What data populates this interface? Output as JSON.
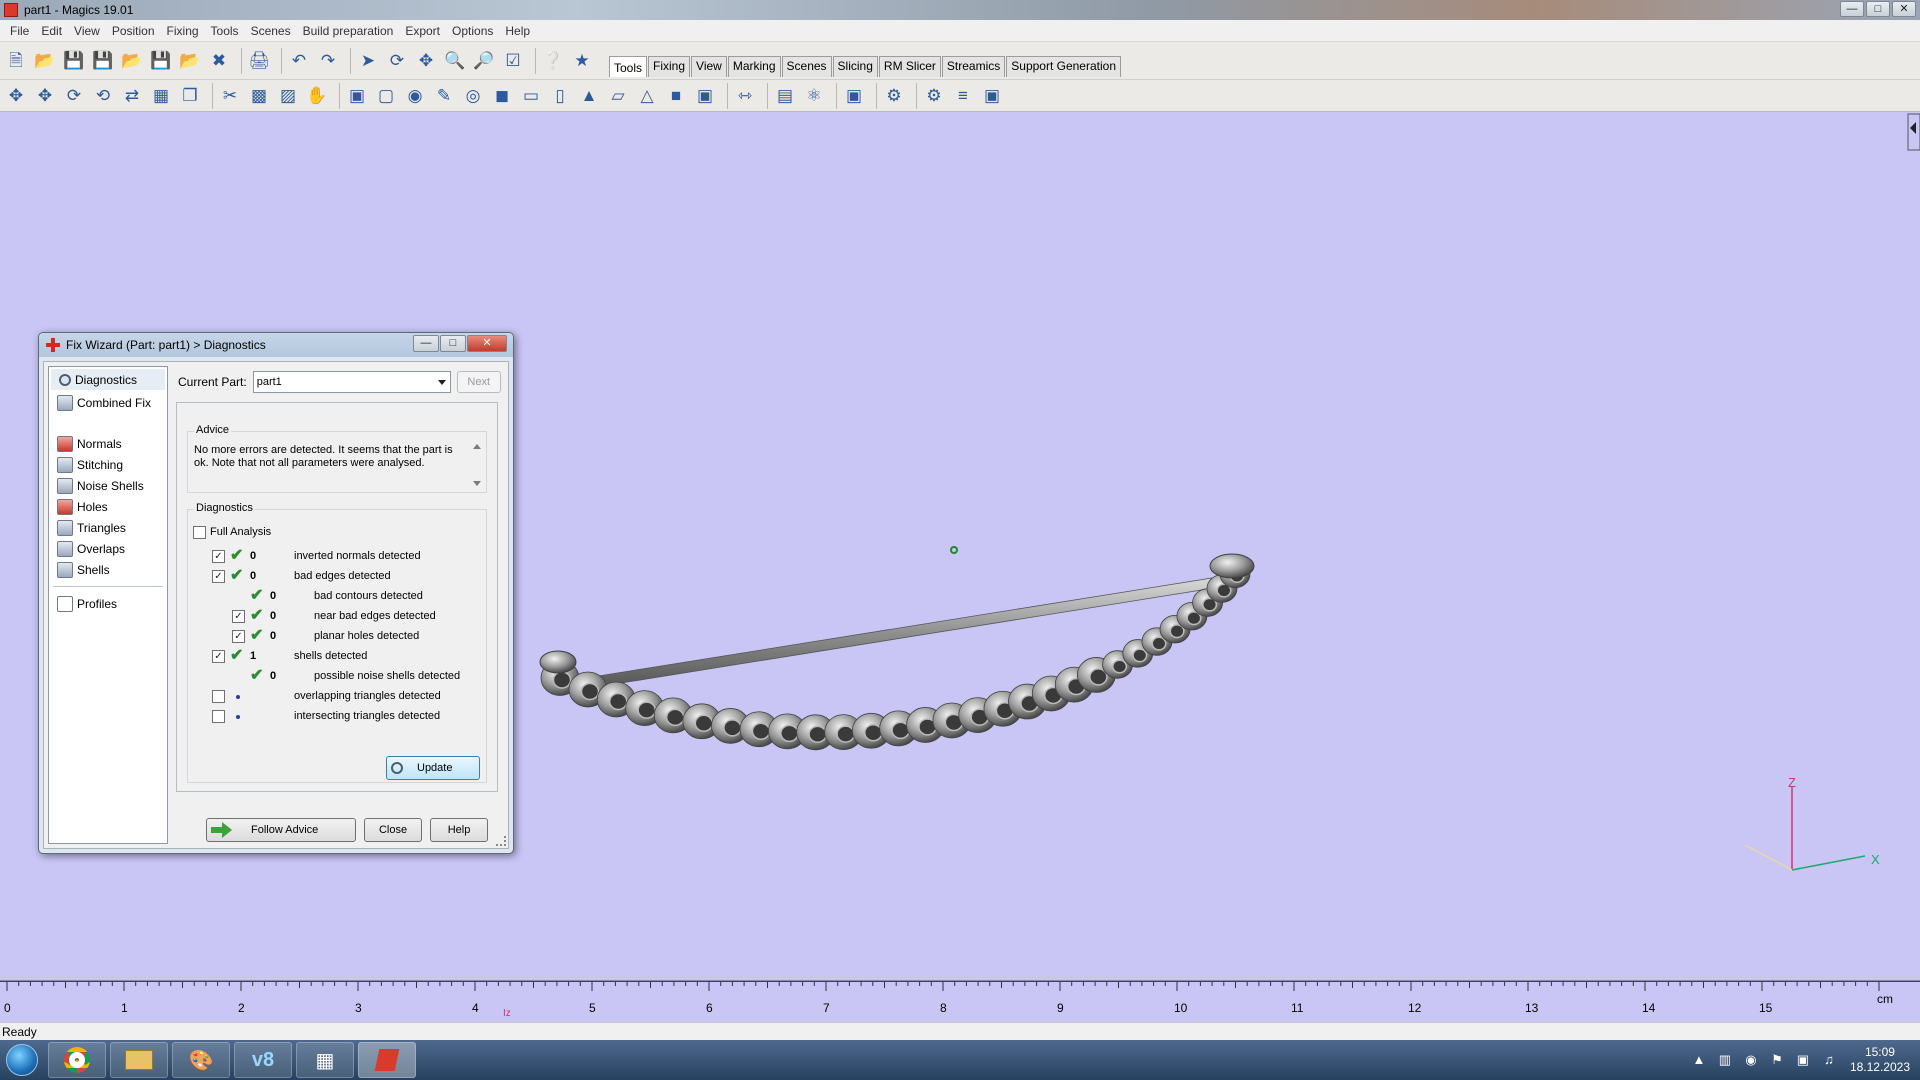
{
  "window": {
    "title": "part1 - Magics 19.01"
  },
  "menubar": [
    "File",
    "Edit",
    "View",
    "Position",
    "Fixing",
    "Tools",
    "Scenes",
    "Build preparation",
    "Export",
    "Options",
    "Help"
  ],
  "toolbar_tabs": [
    {
      "label": "Tools",
      "active": true
    },
    {
      "label": "Fixing",
      "active": false
    },
    {
      "label": "View",
      "active": false
    },
    {
      "label": "Marking",
      "active": false
    },
    {
      "label": "Scenes",
      "active": false
    },
    {
      "label": "Slicing",
      "active": false
    },
    {
      "label": "RM Slicer",
      "active": false
    },
    {
      "label": "Streamics",
      "active": false
    },
    {
      "label": "Support Generation",
      "active": false
    }
  ],
  "dialog": {
    "title": "Fix Wizard (Part: part1) > Diagnostics",
    "current_part_label": "Current Part:",
    "current_part_value": "part1",
    "next_label": "Next",
    "nav": {
      "diagnostics": "Diagnostics",
      "combined_fix": "Combined Fix",
      "normals": "Normals",
      "stitching": "Stitching",
      "noise_shells": "Noise Shells",
      "holes": "Holes",
      "triangles": "Triangles",
      "overlaps": "Overlaps",
      "shells": "Shells",
      "profiles": "Profiles"
    },
    "advice_title": "Advice",
    "advice_text": "No more errors are detected. It seems that the part is ok. Note that not all parameters were analysed.",
    "diagnostics_title": "Diagnostics",
    "full_analysis_label": "Full Analysis",
    "rows": [
      {
        "checked": true,
        "status": "ok",
        "count": "0",
        "label": "inverted normals detected",
        "indent": 0
      },
      {
        "checked": true,
        "status": "ok",
        "count": "0",
        "label": "bad edges detected",
        "indent": 0
      },
      {
        "checked": null,
        "status": "ok",
        "count": "0",
        "label": "bad contours detected",
        "indent": 1
      },
      {
        "checked": true,
        "status": "ok",
        "count": "0",
        "label": "near bad edges detected",
        "indent": 1
      },
      {
        "checked": true,
        "status": "ok",
        "count": "0",
        "label": "planar holes detected",
        "indent": 1
      },
      {
        "checked": true,
        "status": "ok",
        "count": "1",
        "label": "shells detected",
        "indent": 0
      },
      {
        "checked": null,
        "status": "ok",
        "count": "0",
        "label": "possible noise shells detected",
        "indent": 1
      },
      {
        "checked": false,
        "status": "pending",
        "count": "",
        "label": "overlapping triangles detected",
        "indent": 0
      },
      {
        "checked": false,
        "status": "pending",
        "count": "",
        "label": "intersecting triangles detected",
        "indent": 0
      }
    ],
    "update_label": "Update",
    "follow_advice_label": "Follow Advice",
    "close_label": "Close",
    "help_label": "Help"
  },
  "ruler": {
    "ticks": [
      "0",
      "1",
      "2",
      "3",
      "4",
      "5",
      "6",
      "7",
      "8",
      "9",
      "10",
      "11",
      "12",
      "13",
      "14",
      "15"
    ],
    "unit": "cm",
    "marker": "Iz"
  },
  "axes": {
    "z": "Z",
    "x": "X"
  },
  "status": "Ready",
  "clock": {
    "time": "15:09",
    "date": "18.12.2023"
  },
  "colors": {
    "viewport_bg": "#c9c6f5",
    "check": "#2d8c2d",
    "title_red": "#d12a1e"
  }
}
